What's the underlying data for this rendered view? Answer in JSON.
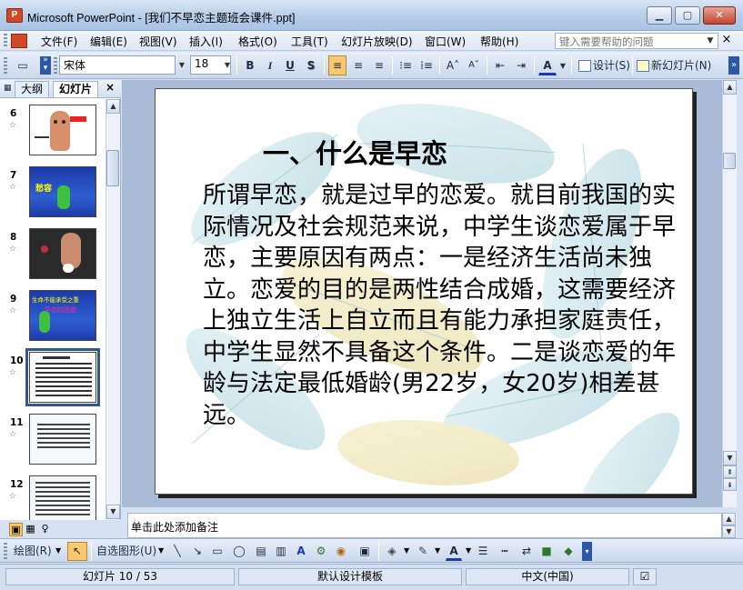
{
  "window": {
    "title": "Microsoft PowerPoint - [我们不早恋主题班会课件.ppt]",
    "app_icon_text": "P",
    "minimize_glyph": "▁",
    "maximize_glyph": "▢",
    "close_glyph": "✕"
  },
  "menu": {
    "items": [
      "文件(F)",
      "编辑(E)",
      "视图(V)",
      "插入(I)",
      "格式(O)",
      "工具(T)",
      "幻灯片放映(D)",
      "窗口(W)",
      "帮助(H)"
    ],
    "help_placeholder": "键入需要帮助的问题",
    "close_glyph": "×"
  },
  "toolbar": {
    "font_name": "宋体",
    "font_size": "18",
    "bold": "B",
    "italic": "I",
    "underline": "U",
    "shadow": "S",
    "align_left": "≡",
    "center": "≡",
    "align_right": "≡",
    "numbered": "⁝≡",
    "bulleted": "⁞≡",
    "grow_font": "A˄",
    "shrink_font": "A˅",
    "decrease_indent": "⇤",
    "increase_indent": "⇥",
    "font_color": "A",
    "design_label": "设计(S)",
    "new_slide_label": "新幻灯片(N)",
    "overflow": "»"
  },
  "left_pane": {
    "tab_outline": "大纲",
    "tab_slides": "幻灯片",
    "close_glyph": "×",
    "slides": [
      {
        "number": "6",
        "star": "☆"
      },
      {
        "number": "7",
        "star": "☆"
      },
      {
        "number": "8",
        "star": "☆"
      },
      {
        "number": "9",
        "star": "☆"
      },
      {
        "number": "10",
        "star": "☆"
      },
      {
        "number": "11",
        "star": "☆"
      },
      {
        "number": "12",
        "star": "☆"
      }
    ],
    "thumb7_text": "愁容",
    "thumb9_title": "生命不能承受之重",
    "thumb9_sub": "早恋的困惑"
  },
  "slide": {
    "title": "一、什么是早恋",
    "body": "所谓早恋，就是过早的恋爱。就目前我国的实际情况及社会规范来说，中学生谈恋爱属于早恋，主要原因有两点：一是经济生活尚未独立。恋爱的目的是两性结合成婚，这需要经济上独立生活上自立而且有能力承担家庭责任，中学生显然不具备这个条件。二是谈恋爱的年龄与法定最低婚龄(男22岁，女20岁)相差甚远。"
  },
  "notes": {
    "placeholder": "单击此处添加备注"
  },
  "drawing_toolbar": {
    "draw_label": "绘图(R)",
    "autoshapes_label": "自选图形(U)"
  },
  "status": {
    "slide_counter": "幻灯片 10 / 53",
    "template": "默认设计模板",
    "language": "中文(中国)"
  },
  "colors": {
    "slide_title": "#000000",
    "thumb_blue": "#1c3aa8",
    "selection": "#30578e"
  }
}
